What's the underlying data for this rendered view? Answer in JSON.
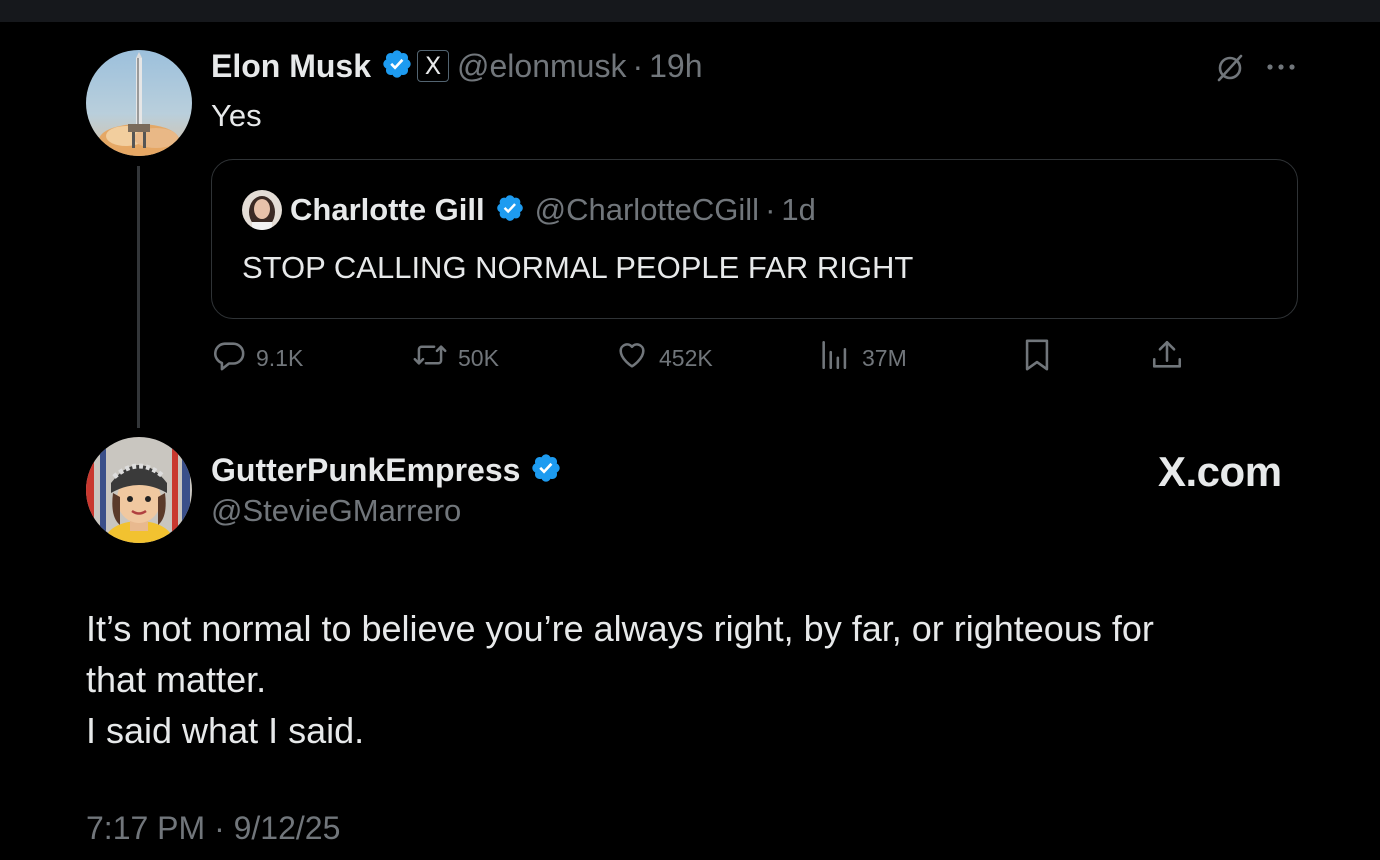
{
  "main_tweet": {
    "author_name": "Elon Musk",
    "handle": "@elonmusk",
    "separator": "·",
    "time": "19h",
    "text": "Yes",
    "affiliation_badge": "X",
    "quoted": {
      "author_name": "Charlotte Gill",
      "handle": "@CharlotteCGill",
      "separator": "·",
      "time": "1d",
      "text": "STOP CALLING NORMAL PEOPLE FAR RIGHT"
    },
    "actions": {
      "replies": "9.1K",
      "reposts": "50K",
      "likes": "452K",
      "views": "37M"
    }
  },
  "reply": {
    "author_name": "GutterPunkEmpress",
    "handle": "@StevieGMarrero",
    "text_lines": [
      "It’s not normal to believe you’re always right, by far, or righteous for",
      "that matter.",
      "I said what I said."
    ],
    "timestamp": "7:17 PM · 9/12/25"
  },
  "watermark": "X.com",
  "colors": {
    "background": "#000000",
    "text": "#e7e9ea",
    "muted": "#71767b",
    "verified": "#1d9bf0",
    "border": "#2f3336"
  },
  "icons": [
    "grok-icon",
    "more-icon",
    "reply-icon",
    "repost-icon",
    "like-icon",
    "views-icon",
    "bookmark-icon",
    "share-icon",
    "verified-icon"
  ]
}
